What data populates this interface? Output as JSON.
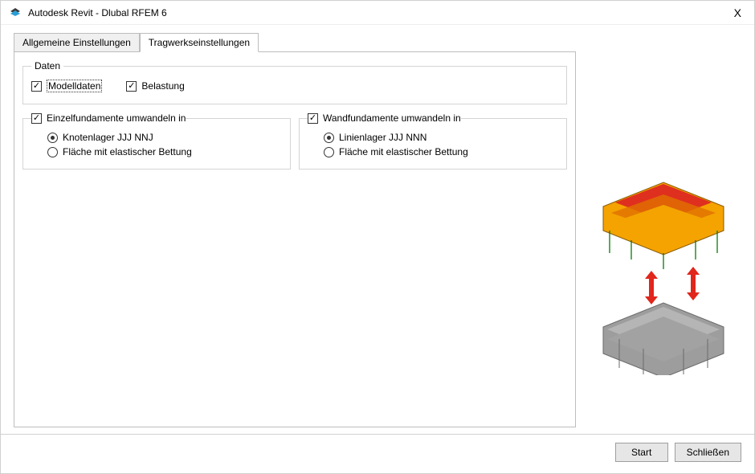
{
  "window": {
    "title": "Autodesk Revit - Dlubal RFEM 6",
    "close_glyph": "X"
  },
  "tabs": {
    "general": "Allgemeine Einstellungen",
    "structural": "Tragwerkseinstellungen"
  },
  "groups": {
    "data": {
      "legend": "Daten",
      "model_data": "Modelldaten",
      "loading": "Belastung"
    },
    "single_foundations": {
      "legend": "Einzelfundamente umwandeln in",
      "option_nodal": "Knotenlager JJJ NNJ",
      "option_surface": "Fläche mit elastischer Bettung"
    },
    "wall_foundations": {
      "legend": "Wandfundamente umwandeln in",
      "option_line": "Linienlager JJJ NNN",
      "option_surface": "Fläche mit elastischer Bettung"
    }
  },
  "buttons": {
    "start": "Start",
    "close": "Schließen"
  }
}
